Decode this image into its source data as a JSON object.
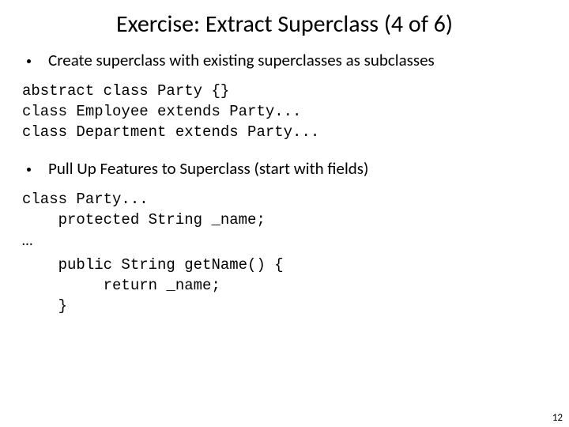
{
  "title": "Exercise: Extract Superclass (4 of 6)",
  "bullets": [
    "Create superclass with existing superclasses as subclasses",
    "Pull Up Features to Superclass (start with fields)"
  ],
  "code1": "abstract class Party {}\nclass Employee extends Party...\nclass Department extends Party...",
  "code2a": "class Party...\n    protected String _name;",
  "ellipsis": "…",
  "code2b": "    public String getName() {\n         return _name;\n    }",
  "page_number": "12"
}
